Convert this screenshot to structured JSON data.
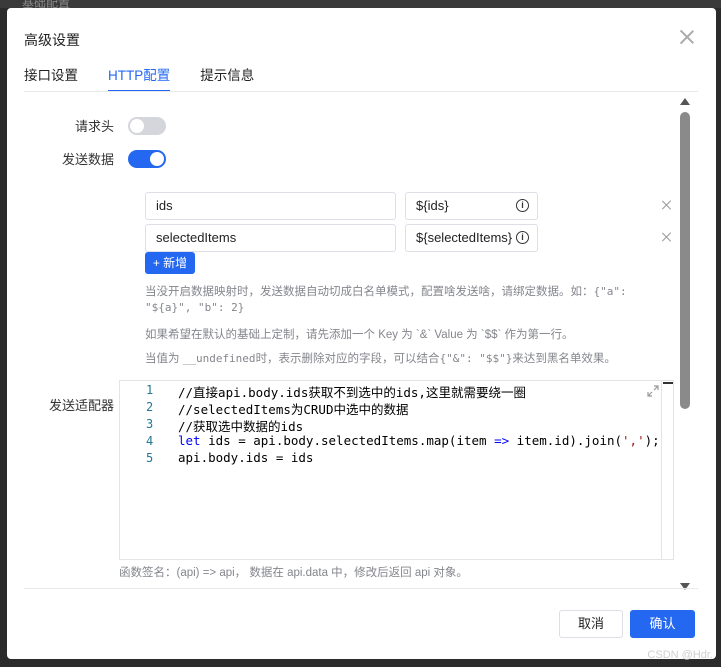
{
  "background": {
    "label": "基础配置"
  },
  "dialog": {
    "title": "高级设置",
    "tabs": [
      {
        "label": "接口设置",
        "active": false
      },
      {
        "label": "HTTP配置",
        "active": true
      },
      {
        "label": "提示信息",
        "active": false
      }
    ]
  },
  "form": {
    "request_headers": {
      "label": "请求头",
      "enabled": false
    },
    "send_data": {
      "label": "发送数据",
      "enabled": true,
      "rows": [
        {
          "key": "ids",
          "value": "${ids}"
        },
        {
          "key": "selectedItems",
          "value": "${selectedItems}"
        }
      ],
      "add_label": "新增",
      "hint1": "当没开启数据映射时，发送数据自动切成白名单模式，配置啥发送啥，请绑定数据。如：",
      "hint1_code": "{\"a\": \"${a}\", \"b\": 2}",
      "hint2": "如果希望在默认的基础上定制，请先添加一个 Key 为 `&` Value 为 `$$` 作为第一行。",
      "hint3_a": "当值为 ",
      "hint3_code1": "__undefined",
      "hint3_b": "时，表示删除对应的字段，可以结合",
      "hint3_code2": "{\"&\": \"$$\"}",
      "hint3_c": "来达到黑名单效果。"
    },
    "adaptor": {
      "label": "发送适配器",
      "line_numbers": [
        "1",
        "2",
        "3",
        "4",
        "5"
      ],
      "lines": [
        "//直接api.body.ids获取不到选中的ids,这里就需要绕一圈",
        "//selectedItems为CRUD中选中的数据",
        "//获取选中数据的ids",
        "let ids = api.body.selectedItems.map(item => item.id).join(',');",
        "api.body.ids = ids"
      ],
      "signature_hint": "函数签名：(api) => api， 数据在 api.data 中，修改后返回 api 对象。"
    }
  },
  "footer": {
    "cancel": "取消",
    "confirm": "确认"
  },
  "watermark": "CSDN @Hdr.",
  "colors": {
    "primary": "#2468f2",
    "comment": "#008000",
    "keyword": "#0000ff",
    "string": "#a31515"
  }
}
